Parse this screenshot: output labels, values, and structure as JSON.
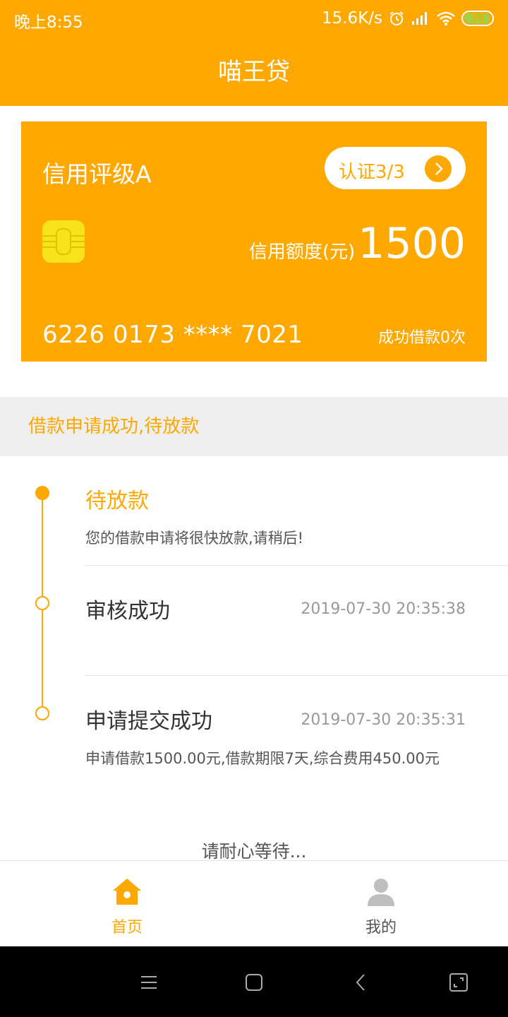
{
  "status_bar": {
    "time": "晚上8:55",
    "net_speed": "15.6K/s",
    "battery": "30"
  },
  "header": {
    "title": "喵王贷"
  },
  "card": {
    "grade": "信用评级A",
    "cert_label": "认证3/3",
    "limit_label": "信用额度(元)",
    "limit_value": "1500",
    "card_number": "6226 0173 **** 7021",
    "loan_count": "成功借款0次"
  },
  "notice": {
    "text": "借款申请成功,待放款"
  },
  "timeline": [
    {
      "title": "待放款",
      "desc": "您的借款申请将很快放款,请稍后!",
      "time": "",
      "active": true
    },
    {
      "title": "审核成功",
      "desc": "",
      "time": "2019-07-30 20:35:38",
      "active": false
    },
    {
      "title": "申请提交成功",
      "desc": "申请借款1500.00元,借款期限7天,综合费用450.00元",
      "time": "2019-07-30 20:35:31",
      "active": false
    }
  ],
  "wait_text": "请耐心等待...",
  "bottom_nav": [
    {
      "label": "首页",
      "icon": "home-icon",
      "active": true
    },
    {
      "label": "我的",
      "icon": "user-icon",
      "active": false
    }
  ],
  "colors": {
    "accent": "#ffa800",
    "chip": "#f7e31a",
    "battery_fill": "#9bd34a"
  }
}
